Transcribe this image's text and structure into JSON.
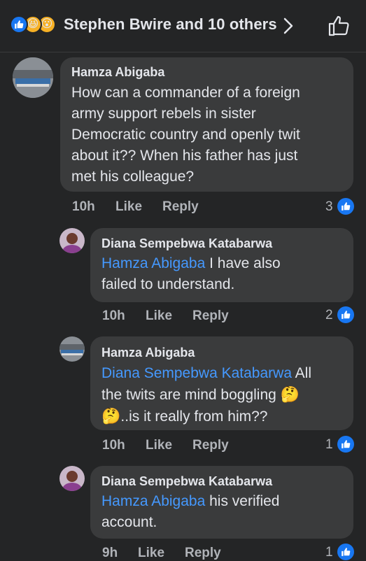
{
  "header": {
    "reactors": "Stephen Bwire and 10 others"
  },
  "comments": [
    {
      "author": "Hamza Abigaba",
      "lines": [
        "How can a commander of a foreign",
        "army support rebels in sister",
        "Democratic country and openly twit",
        "about it?? When his father has just",
        "met his colleague?"
      ],
      "time": "10h",
      "like_label": "Like",
      "reply_label": "Reply",
      "likes": "3"
    },
    {
      "author": "Diana Sempebwa Katabarwa",
      "mention": "Hamza Abigaba",
      "line1_rest": " I have also",
      "line2": "failed to understand.",
      "time": "10h",
      "like_label": "Like",
      "reply_label": "Reply",
      "likes": "2"
    },
    {
      "author": "Hamza Abigaba",
      "mention": "Diana Sempebwa Katabarwa",
      "line1_rest": " All",
      "line2": "the twits are mind boggling ",
      "line3": "..is it really from him??",
      "emoji": "🤔",
      "time": "10h",
      "like_label": "Like",
      "reply_label": "Reply",
      "likes": "1"
    },
    {
      "author": "Diana Sempebwa Katabarwa",
      "mention": "Hamza Abigaba",
      "line1_rest": " his verified",
      "line2": "account.",
      "time": "9h",
      "like_label": "Like",
      "reply_label": "Reply",
      "likes": "1"
    }
  ],
  "colors": {
    "background": "#242526",
    "bubble": "#3a3b3c",
    "mention": "#4599ff",
    "like_blue": "#1877f2",
    "meta_text": "#b0b3b8"
  }
}
